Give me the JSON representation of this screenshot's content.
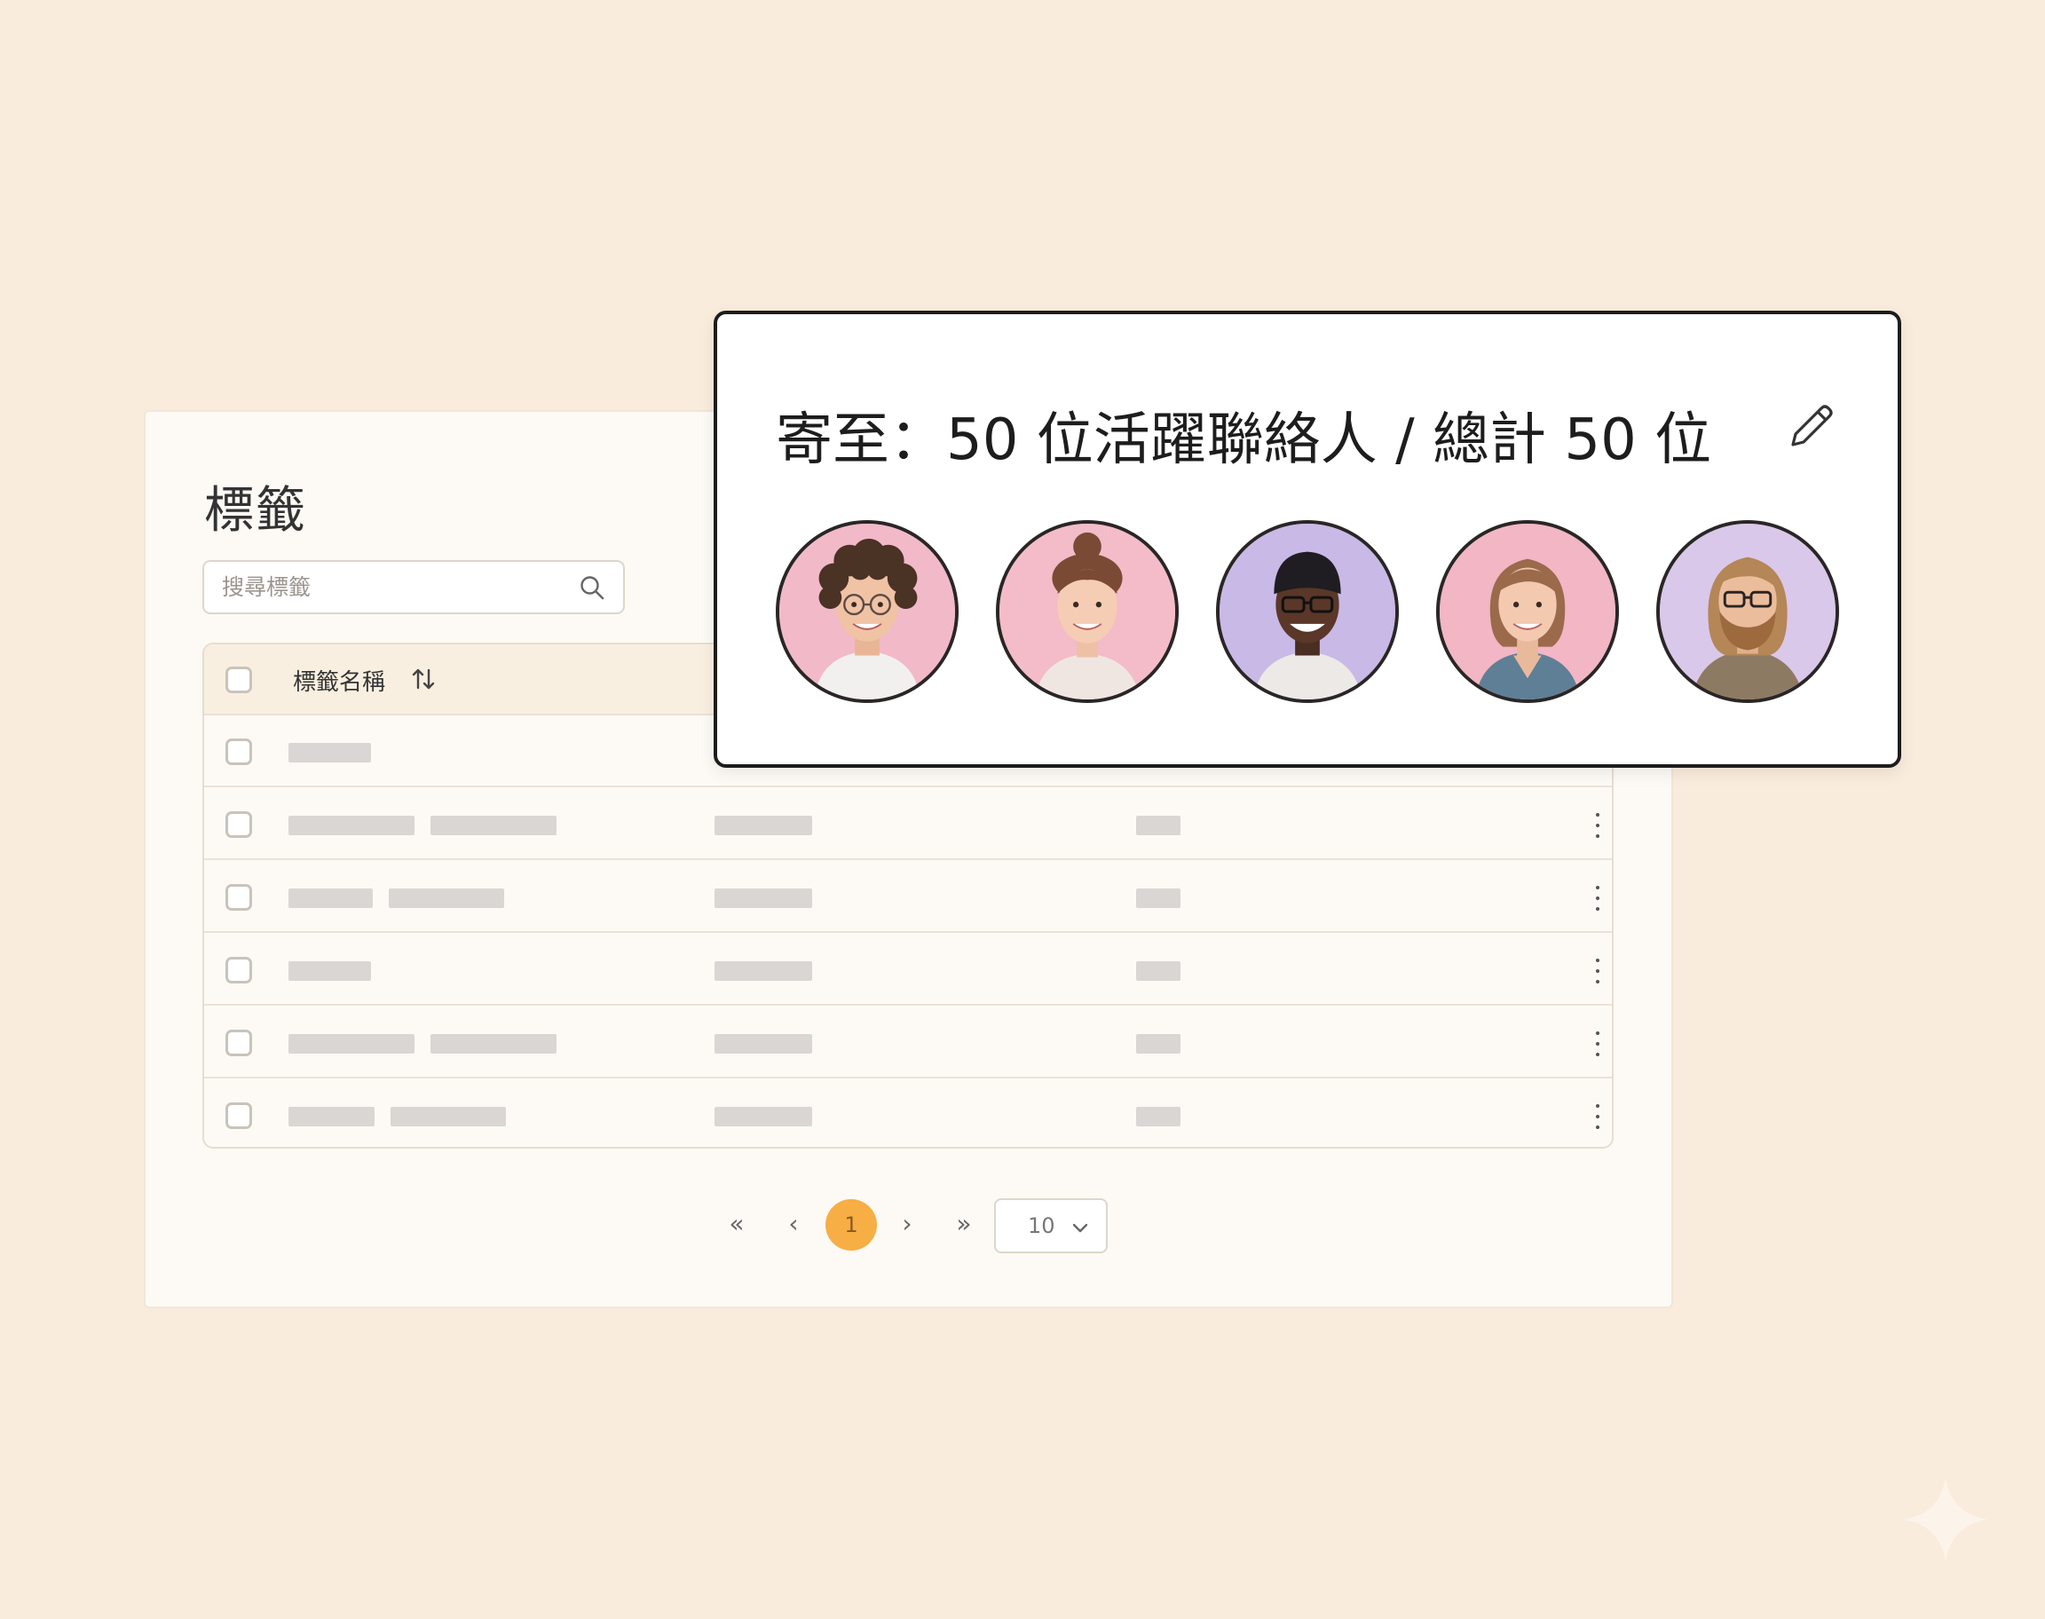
{
  "tags_panel": {
    "title": "標籤",
    "search": {
      "placeholder": "搜尋標籤",
      "value": ""
    },
    "table": {
      "header_name": "標籤名稱",
      "rows": 6
    },
    "pagination": {
      "first": "«",
      "prev": "‹",
      "current_page": "1",
      "next": "›",
      "last": "»",
      "page_size": "10"
    }
  },
  "recipient_card": {
    "title": "寄至：50 位活躍聯絡人 / 總計 50 位",
    "avatars": [
      {
        "name": "avatar-1",
        "bg": "#f2b9c9"
      },
      {
        "name": "avatar-2",
        "bg": "#f3bcc8"
      },
      {
        "name": "avatar-3",
        "bg": "#c9b9e6"
      },
      {
        "name": "avatar-4",
        "bg": "#f2b6c4"
      },
      {
        "name": "avatar-5",
        "bg": "#d9c8e9"
      }
    ]
  },
  "colors": {
    "background": "#f9ecdd",
    "accent": "#f7ae45",
    "card_border": "#1d1d1d"
  },
  "icons": [
    "search-icon",
    "sort-icon",
    "kebab-menu-icon",
    "chevron-down-icon",
    "pencil-edit-icon",
    "sparkle-icon"
  ]
}
